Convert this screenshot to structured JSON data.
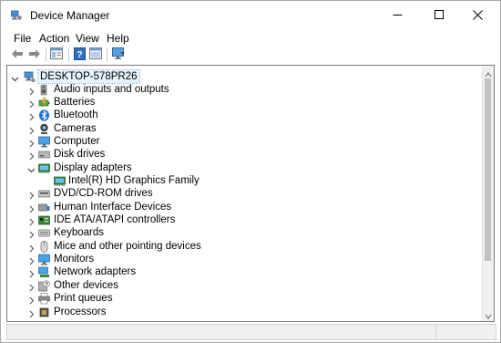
{
  "window": {
    "title": "Device Manager",
    "controls": {
      "minimize": "minimize",
      "maximize": "maximize",
      "close": "close"
    }
  },
  "menu": {
    "items": [
      "File",
      "Action",
      "View",
      "Help"
    ]
  },
  "toolbar": {
    "buttons": [
      "back-arrow",
      "forward-arrow",
      "properties",
      "help",
      "update-driver",
      "scan-hardware"
    ]
  },
  "tree": {
    "root": "DESKTOP-578PR26",
    "categories": [
      {
        "label": "Audio inputs and outputs",
        "icon": "speaker-icon",
        "expanded": false
      },
      {
        "label": "Batteries",
        "icon": "battery-icon",
        "expanded": false
      },
      {
        "label": "Bluetooth",
        "icon": "bluetooth-icon",
        "expanded": false
      },
      {
        "label": "Cameras",
        "icon": "camera-icon",
        "expanded": false
      },
      {
        "label": "Computer",
        "icon": "computer-icon",
        "expanded": false
      },
      {
        "label": "Disk drives",
        "icon": "disk-drive-icon",
        "expanded": false
      },
      {
        "label": "Display adapters",
        "icon": "display-adapter-icon",
        "expanded": true,
        "children": [
          "Intel(R) HD Graphics Family"
        ]
      },
      {
        "label": "DVD/CD-ROM drives",
        "icon": "dvd-drive-icon",
        "expanded": false
      },
      {
        "label": "Human Interface Devices",
        "icon": "hid-icon",
        "expanded": false
      },
      {
        "label": "IDE ATA/ATAPI controllers",
        "icon": "ide-controller-icon",
        "expanded": false
      },
      {
        "label": "Keyboards",
        "icon": "keyboard-icon",
        "expanded": false
      },
      {
        "label": "Mice and other pointing devices",
        "icon": "mouse-icon",
        "expanded": false
      },
      {
        "label": "Monitors",
        "icon": "monitor-icon",
        "expanded": false
      },
      {
        "label": "Network adapters",
        "icon": "network-adapter-icon",
        "expanded": false
      },
      {
        "label": "Other devices",
        "icon": "other-devices-icon",
        "expanded": false
      },
      {
        "label": "Print queues",
        "icon": "printer-icon",
        "expanded": false
      },
      {
        "label": "Processors",
        "icon": "processor-icon",
        "expanded": false
      }
    ]
  },
  "colors": {
    "selection": "#e5f3ff",
    "accent": "#1e88d7"
  }
}
